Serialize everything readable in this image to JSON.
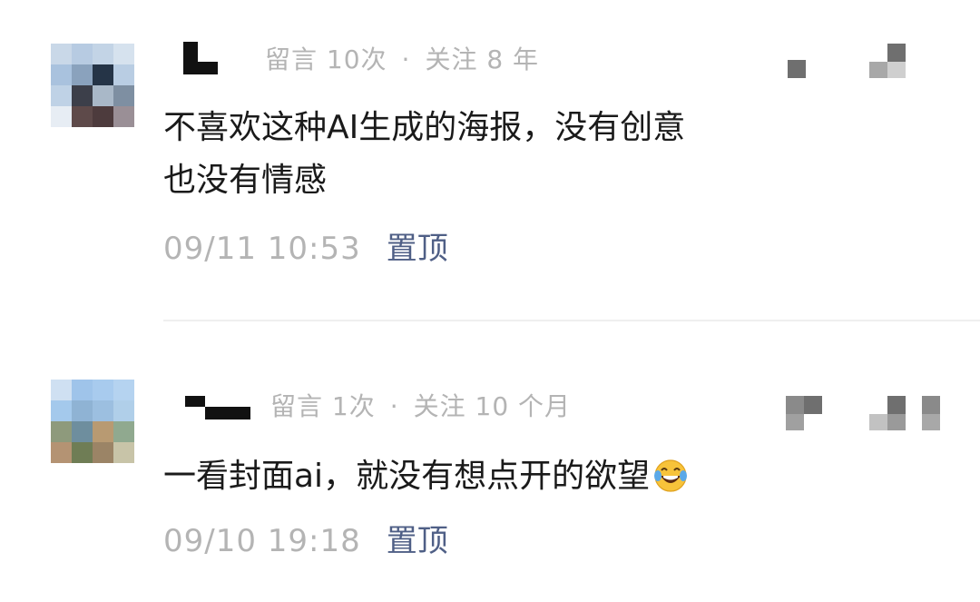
{
  "comments": [
    {
      "meta": {
        "messages": "留言 10次",
        "following": "关注 8 年",
        "separator": "·"
      },
      "text_lines": [
        "不喜欢这种AI生成的海报，没有创意",
        "也没有情感"
      ],
      "timestamp": "09/11 10:53",
      "pin_label": "置顶"
    },
    {
      "meta": {
        "messages": "留言 1次",
        "following": "关注 10 个月",
        "separator": "·"
      },
      "text_lines": [
        "一看封面ai，就没有想点开的欲望"
      ],
      "emoji": "laughing-tears-emoji",
      "timestamp": "09/10 19:18",
      "pin_label": "置顶"
    }
  ],
  "colors": {
    "meta_gray": "#b4b4b4",
    "pin_blue": "#4f5f86",
    "text": "#1a1a1a",
    "divider": "#efefef"
  }
}
